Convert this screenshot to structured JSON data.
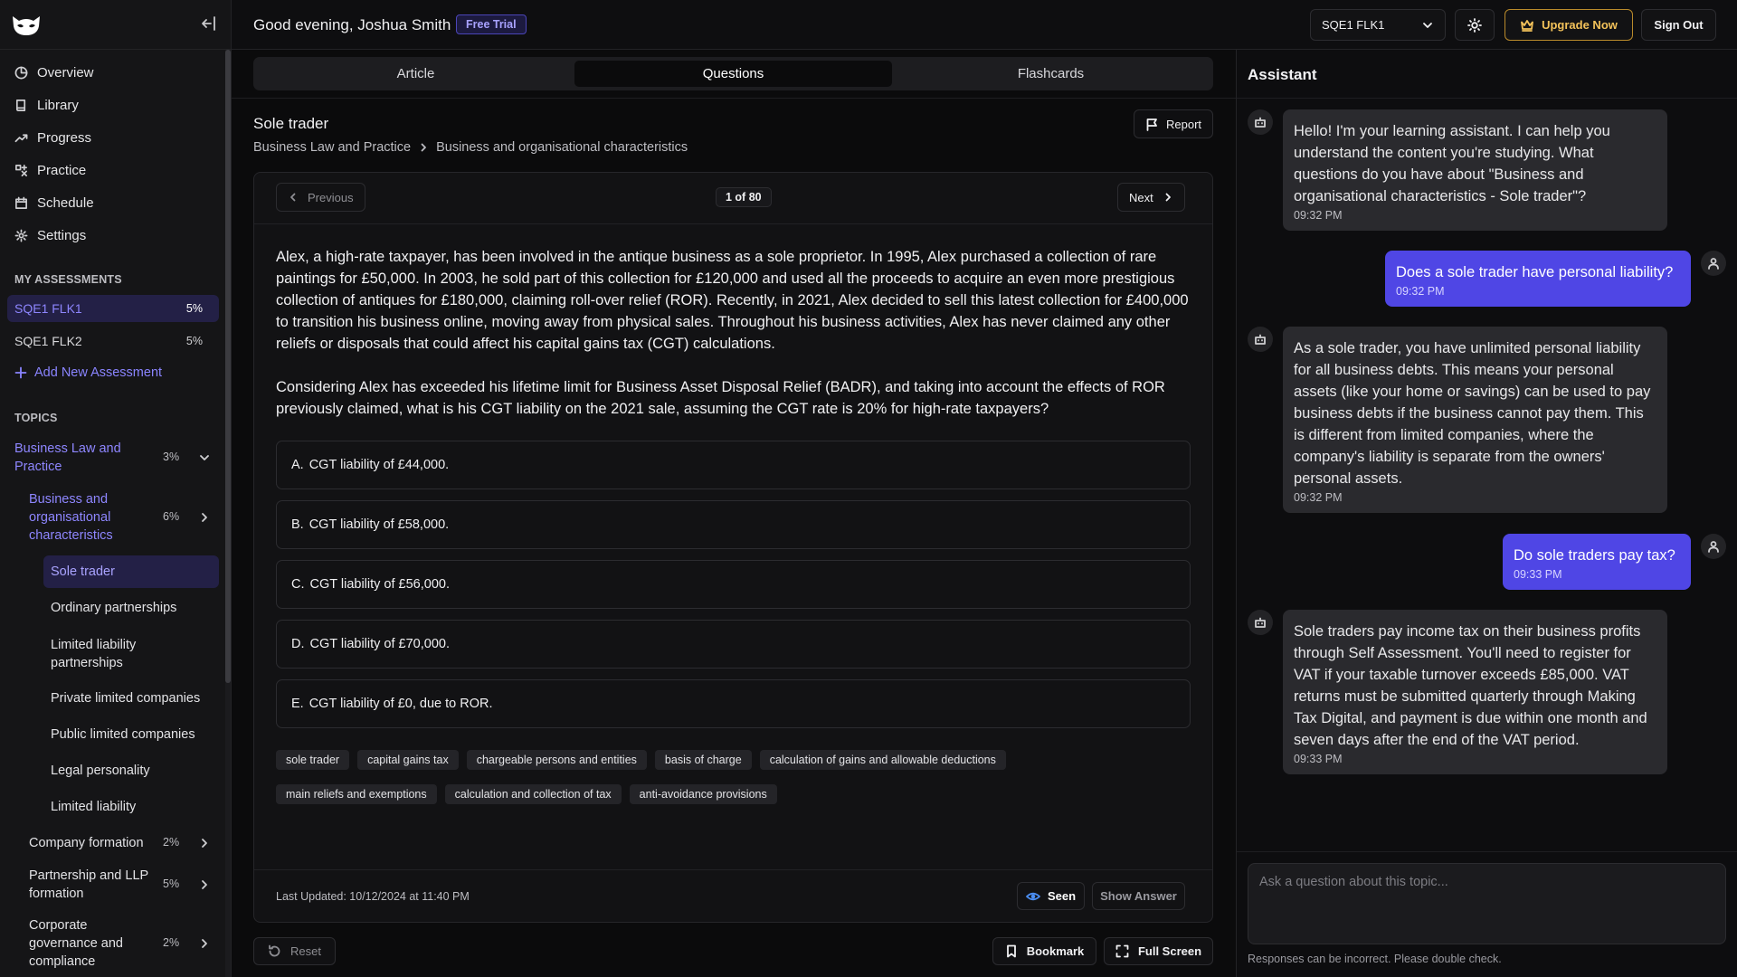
{
  "header": {
    "greeting": "Good evening, Joshua Smith",
    "trial_badge": "Free Trial",
    "assessment_select": "SQE1 FLK1",
    "upgrade_label": "Upgrade Now",
    "signout_label": "Sign Out"
  },
  "sidebar": {
    "nav": [
      {
        "label": "Overview",
        "icon": "clock-icon"
      },
      {
        "label": "Library",
        "icon": "book-icon"
      },
      {
        "label": "Progress",
        "icon": "trend-icon"
      },
      {
        "label": "Practice",
        "icon": "practice-icon"
      },
      {
        "label": "Schedule",
        "icon": "calendar-icon"
      },
      {
        "label": "Settings",
        "icon": "gear-icon"
      }
    ],
    "assessments_heading": "MY ASSESSMENTS",
    "assessments": [
      {
        "name": "SQE1 FLK1",
        "pct": "5%"
      },
      {
        "name": "SQE1 FLK2",
        "pct": "5%"
      }
    ],
    "add_assessment": "Add New Assessment",
    "topics_heading": "TOPICS",
    "topics": [
      {
        "label": "Business Law and Practice",
        "pct": "3%"
      },
      {
        "label": "Business and organisational characteristics",
        "pct": "6%"
      },
      {
        "label": "Company formation",
        "pct": "2%"
      },
      {
        "label": "Partnership and LLP formation",
        "pct": "5%"
      },
      {
        "label": "Corporate governance and compliance",
        "pct": "2%"
      }
    ],
    "subtopics": [
      "Sole trader",
      "Ordinary partnerships",
      "Limited liability partnerships",
      "Private limited companies",
      "Public limited companies",
      "Legal personality",
      "Limited liability"
    ]
  },
  "main": {
    "tabs": [
      "Article",
      "Questions",
      "Flashcards"
    ],
    "active_tab": "Questions",
    "title": "Sole trader",
    "breadcrumb": [
      "Business Law and Practice",
      "Business and organisational characteristics"
    ],
    "report_label": "Report",
    "previous_label": "Previous",
    "next_label": "Next",
    "counter": "1 of 80",
    "question_paragraph_1": "Alex, a high-rate taxpayer, has been involved in the antique business as a sole proprietor. In 1995, Alex purchased a collection of rare paintings for £50,000. In 2003, he sold part of this collection for £120,000 and used all the proceeds to acquire an even more prestigious collection of antiques for £180,000, claiming roll-over relief (ROR). Recently, in 2021, Alex decided to sell this latest collection for £400,000 to transition his business online, moving away from physical sales. Throughout his business activities, Alex has never claimed any other reliefs or disposals that could affect his capital gains tax (CGT) calculations.",
    "question_paragraph_2": "Considering Alex has exceeded his lifetime limit for Business Asset Disposal Relief (BADR), and taking into account the effects of ROR previously claimed, what is his CGT liability on the 2021 sale, assuming the CGT rate is 20% for high-rate taxpayers?",
    "options": [
      {
        "letter": "A.",
        "text": "CGT liability of £44,000."
      },
      {
        "letter": "B.",
        "text": "CGT liability of £58,000."
      },
      {
        "letter": "C.",
        "text": "CGT liability of £56,000."
      },
      {
        "letter": "D.",
        "text": "CGT liability of £70,000."
      },
      {
        "letter": "E.",
        "text": "CGT liability of £0, due to ROR."
      }
    ],
    "tags": [
      "sole trader",
      "capital gains tax",
      "chargeable persons and entities",
      "basis of charge",
      "calculation of gains and allowable deductions",
      "main reliefs and exemptions",
      "calculation and collection of tax",
      "anti-avoidance provisions"
    ],
    "last_updated": "Last Updated: 10/12/2024 at 11:40 PM",
    "seen_label": "Seen",
    "show_answer_label": "Show Answer",
    "reset_label": "Reset",
    "bookmark_label": "Bookmark",
    "fullscreen_label": "Full Screen"
  },
  "assistant": {
    "title": "Assistant",
    "messages": [
      {
        "role": "bot",
        "text": "Hello! I'm your learning assistant. I can help you understand the content you're studying. What questions do you have about \"Business and organisational characteristics - Sole trader\"?",
        "time": "09:32 PM"
      },
      {
        "role": "user",
        "text": "Does a sole trader have personal liability?",
        "time": "09:32 PM"
      },
      {
        "role": "bot",
        "text": "As a sole trader, you have unlimited personal liability for all business debts. This means your personal assets (like your home or savings) can be used to pay business debts if the business cannot pay them. This is different from limited companies, where the company's liability is separate from the owners' personal assets.",
        "time": "09:32 PM"
      },
      {
        "role": "user",
        "text": "Do sole traders pay tax?",
        "time": "09:33 PM"
      },
      {
        "role": "bot",
        "text": "Sole traders pay income tax on their business profits through Self Assessment. You'll need to register for VAT if your taxable turnover exceeds £85,000. VAT returns must be submitted quarterly through Making Tax Digital, and payment is due within one month and seven days after the end of the VAT period.",
        "time": "09:33 PM"
      }
    ],
    "input_placeholder": "Ask a question about this topic...",
    "disclaimer": "Responses can be incorrect. Please double check."
  },
  "colors": {
    "accent": "#4f46e5",
    "accent_text": "#8e86ff",
    "upgrade": "#f3c25a",
    "seen_icon": "#4b8ff5"
  }
}
